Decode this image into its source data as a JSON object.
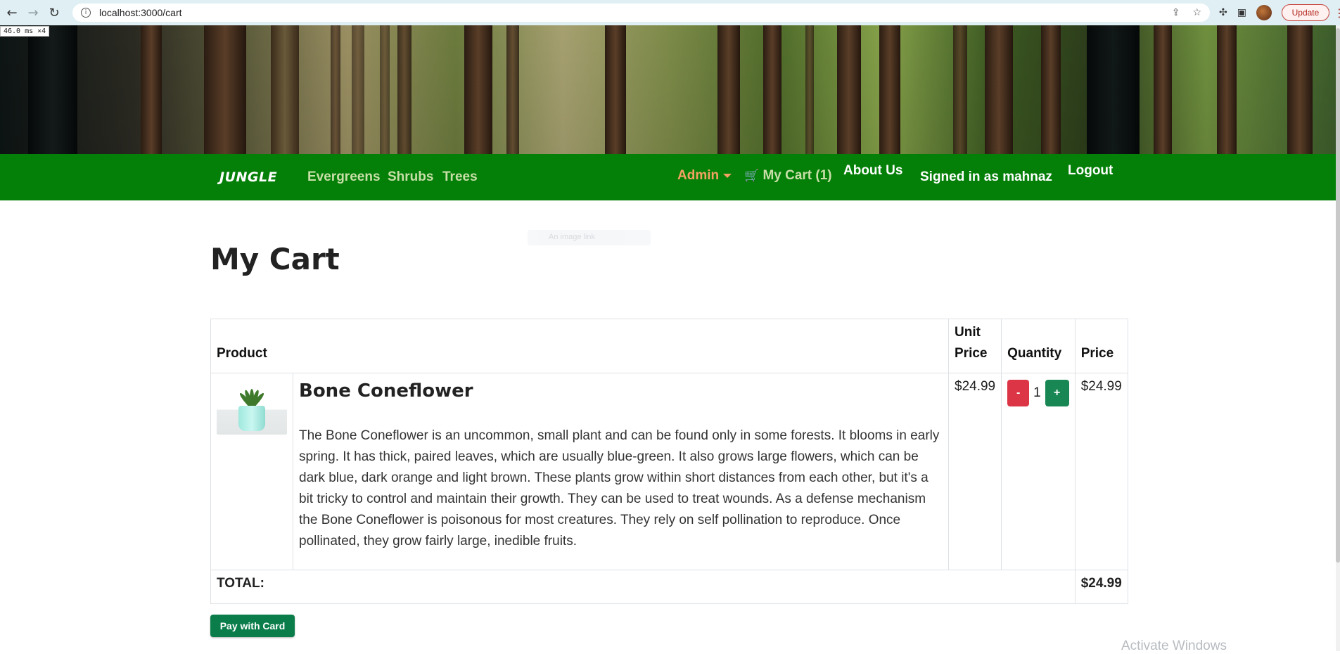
{
  "browser": {
    "url": "localhost:3000/cart",
    "update_label": "Update",
    "perf_badge": "46.0 ms ×4"
  },
  "nav": {
    "brand": "JUNGLE",
    "categories": [
      "Evergreens",
      "Shrubs",
      "Trees"
    ],
    "admin": "Admin",
    "cart": "My Cart (1)",
    "about": "About Us",
    "signed_in": "Signed in as mahnaz",
    "logout": "Logout"
  },
  "tooltip_faint": "An image link",
  "page": {
    "title": "My Cart"
  },
  "cart": {
    "headers": {
      "product": "Product",
      "unit_price": "Unit Price",
      "quantity": "Quantity",
      "price": "Price"
    },
    "items": [
      {
        "name": "Bone Coneflower",
        "description": "The Bone Coneflower is an uncommon, small plant and can be found only in some forests. It blooms in early spring. It has thick, paired leaves, which are usually blue-green. It also grows large flowers, which can be dark blue, dark orange and light brown. These plants grow within short distances from each other, but it's a bit tricky to control and maintain their growth. They can be used to treat wounds. As a defense mechanism the Bone Coneflower is poisonous for most creatures. They rely on self pollination to reproduce. Once pollinated, they grow fairly large, inedible fruits.",
        "unit_price": "$24.99",
        "quantity": "1",
        "minus": "-",
        "plus": "+",
        "price": "$24.99"
      }
    ],
    "total_label": "TOTAL:",
    "total_value": "$24.99"
  },
  "pay_button": "Pay with Card",
  "watermark": "Activate Windows",
  "colors": {
    "nav_bg": "#047f08",
    "admin": "#f4a261",
    "minus_btn": "#dc3545",
    "plus_btn": "#198754",
    "pay_btn": "#0a7d4a"
  }
}
